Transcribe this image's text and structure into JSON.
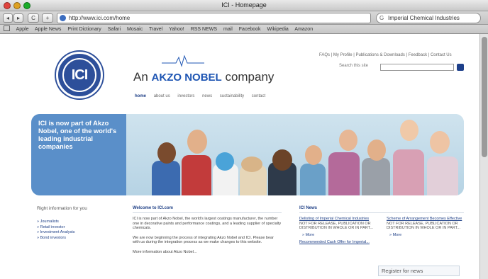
{
  "window": {
    "title": "ICI - Homepage"
  },
  "toolbar": {
    "back": "◂",
    "forward": "▸",
    "reload": "C",
    "add": "+",
    "url": "http://www.ici.com/home",
    "search_text": "Imperial Chemical Industries",
    "search_icon": "google-search-icon"
  },
  "bookmarks": [
    "Apple",
    "Apple News",
    "Print Dictionary",
    "Safari",
    "Mosaic",
    "Travel",
    "Yahoo!",
    "RSS NEWS",
    "mail",
    "Facebook",
    "Wikipedia",
    "Amazon"
  ],
  "site": {
    "logo": "ICI",
    "tagline_prefix": "An",
    "tagline_brand": "AKZO NOBEL",
    "tagline_suffix": "company",
    "nav": [
      "home",
      "about us",
      "investors",
      "news",
      "sustainability",
      "contact"
    ],
    "utility": "FAQs | My Profile | Publications & Downloads | Feedback | Contact Us",
    "search_label": "Search this site",
    "hero_text": "ICI is now part of Akzo Nobel, one of the world's leading industrial companies",
    "info_title": "Right information for you",
    "info_links": [
      "Journalists",
      "Retail investor",
      "Investment Analysts",
      "Bond investors"
    ],
    "welcome_title": "Welcome to ICI.com",
    "welcome_p1": "ICI is now part of Akzo Nobel, the world's largest coatings manufacturer, the number one in decorative paints and performance coatings, and a leading supplier of specialty chemicals.",
    "welcome_p2": "We are now beginning the process of integrating Akzo Nobel and ICI. Please bear with us during the integration process as we make changes to this website.",
    "welcome_p3": "More information about Akzo Nobel...",
    "news_title": "ICI News",
    "news_left_link": "Delisting of Imperial Chemical Industries",
    "news_left_caps": "NOT FOR RELEASE, PUBLICATION OR DISTRIBUTION IN WHOLE OR IN PART...",
    "news_left_more": "More",
    "news_left_link2": "Recommended Cash Offer for Imperial...",
    "news_right_link": "Scheme of Arrangement Becomes Effective",
    "news_right_caps": "NOT FOR RELEASE, PUBLICATION OR DISTRIBUTION IN WHOLE OR IN PART...",
    "news_right_more": "More",
    "register": "Register for news"
  }
}
